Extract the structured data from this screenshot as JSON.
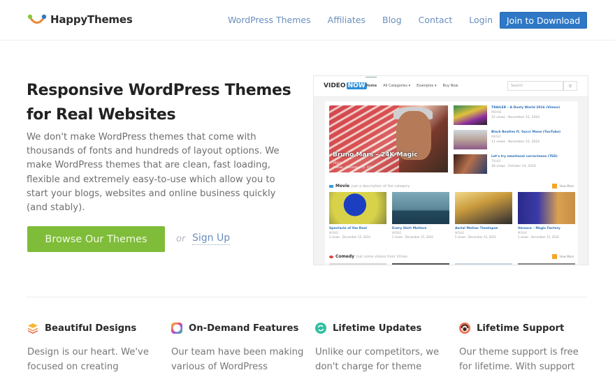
{
  "header": {
    "brand": "HappyThemes",
    "nav": [
      "WordPress Themes",
      "Affiliates",
      "Blog",
      "Contact",
      "Login"
    ],
    "cta": "Join to Download",
    "cta_color": "#2e78c6"
  },
  "hero": {
    "title_line1": "Responsive WordPress Themes",
    "title_line2": "for Real Websites",
    "description": "We don't make WordPress themes that come with thousands of fonts and hundreds of layout options. We make WordPress themes that are clean, fast loading, flexible and extremely easy-to-use which allow you to start your blogs, websites and online business quickly (and stably).",
    "primary_button": "Browse Our Themes",
    "primary_color": "#7fbc3a",
    "or_text": "or",
    "secondary_link": "Sign Up"
  },
  "preview": {
    "logo_a": "VIDEO",
    "logo_b": "NOW",
    "nav": [
      "Home",
      "All Categories ▾",
      "Examples ▾",
      "Buy Now"
    ],
    "search_placeholder": "Search",
    "featured": {
      "title": "Bruno Mars – 24K Magic",
      "category": "VIDEO",
      "meta": "3 views · December 15, 2016"
    },
    "side_items": [
      {
        "title": "TRAILER – A Dusty World 2016 (Vimeo)",
        "category": "MOVIE",
        "meta": "15 views · November 15, 2016"
      },
      {
        "title": "Black Beatles ft. Gucci Mane (YouTube)",
        "category": "MUSIC",
        "meta": "11 views · November 15, 2016"
      },
      {
        "title": "Let's try emotional correctness (TED)",
        "category": "TALKS",
        "meta": "18 views · October 14, 2016"
      }
    ],
    "categories": [
      {
        "name": "Movie",
        "description": "Just a description of the category",
        "view_more": "View More"
      },
      {
        "name": "Comedy",
        "description": "Just some videos from Vimeo",
        "view_more": "View More"
      }
    ],
    "movie_items": [
      {
        "title": "Spectacle of the Real",
        "category": "MOVIE",
        "meta": "3 views · December 15, 2016"
      },
      {
        "title": "Every Shirt Matters",
        "category": "MOVIE",
        "meta": "2 views · December 15, 2016"
      },
      {
        "title": "Aerial Motion Timelapse",
        "category": "MOVIE",
        "meta": "5 views · December 15, 2016"
      },
      {
        "title": "Versace – Magic Factory",
        "category": "MOVIE",
        "meta": "1 views · December 15, 2016"
      }
    ]
  },
  "features": [
    {
      "icon": "layers-icon",
      "title": "Beautiful Designs",
      "description": "Design is our heart. We've focused on creating"
    },
    {
      "icon": "color-wheel-icon",
      "title": "On-Demand Features",
      "description": "Our team have been making various of WordPress"
    },
    {
      "icon": "refresh-icon",
      "title": "Lifetime Updates",
      "description": "Unlike our competitors, we don't charge for theme"
    },
    {
      "icon": "support-icon",
      "title": "Lifetime Support",
      "description": "Our theme support is free for lifetime. With support"
    }
  ]
}
